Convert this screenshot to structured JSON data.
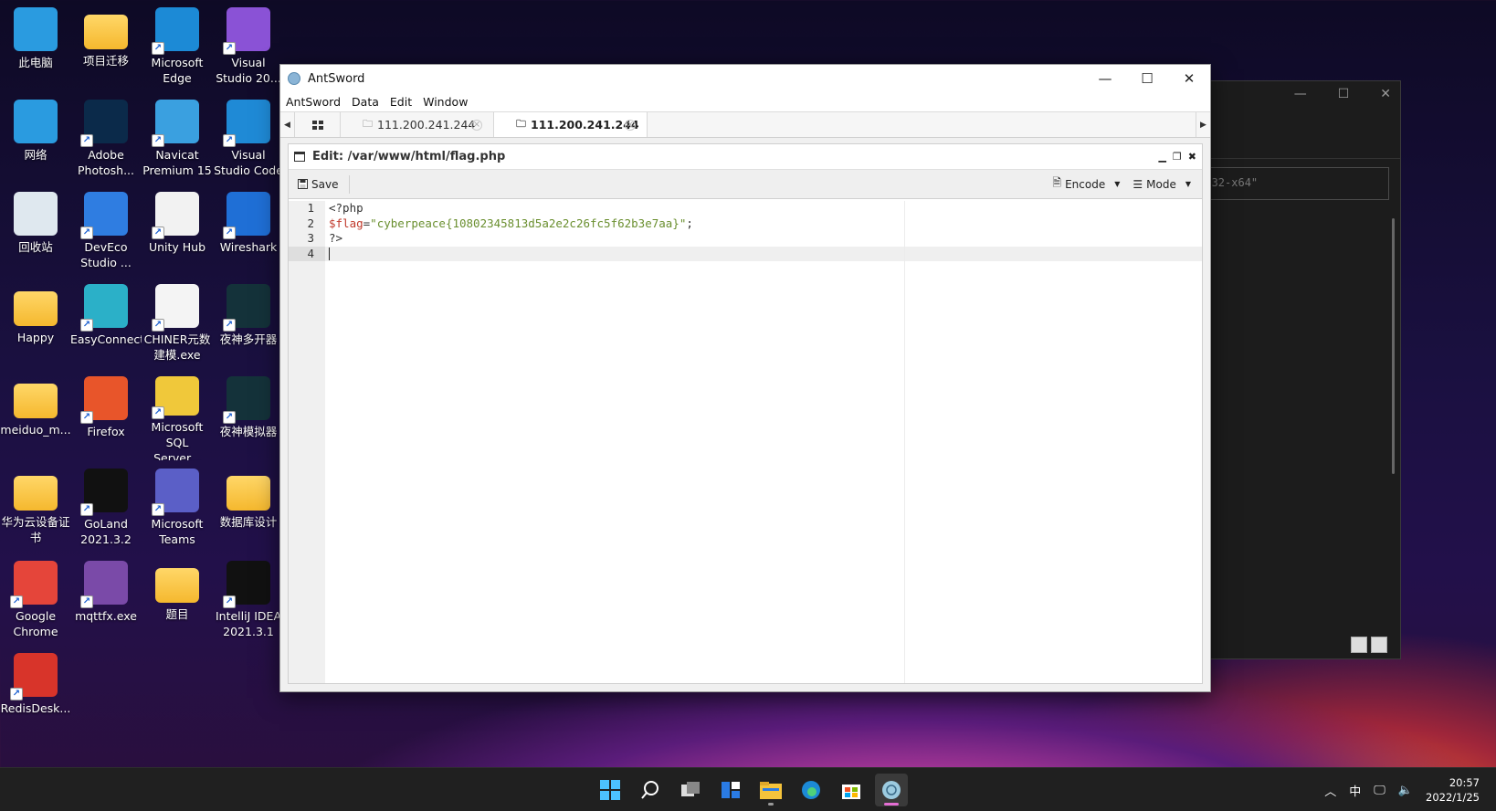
{
  "desktop": {
    "icons": [
      {
        "label": "此电脑",
        "icon": "computer-icon",
        "color": "#2a9be0"
      },
      {
        "label": "项目迁移",
        "icon": "folder-icon",
        "color": "#f5b82e"
      },
      {
        "label": "Microsoft Edge",
        "icon": "edge-icon",
        "color": "#1c8ad6"
      },
      {
        "label": "Visual Studio 20...",
        "icon": "visual-studio-icon",
        "color": "#8a52d6"
      },
      {
        "label": "网络",
        "icon": "network-icon",
        "color": "#2a9be0"
      },
      {
        "label": "Adobe Photosh...",
        "icon": "photoshop-icon",
        "color": "#0b2a4a"
      },
      {
        "label": "Navicat Premium 15",
        "icon": "navicat-icon",
        "color": "#3aa0e0"
      },
      {
        "label": "Visual Studio Code",
        "icon": "vscode-icon",
        "color": "#1f8ad6"
      },
      {
        "label": "回收站",
        "icon": "recycle-bin-icon",
        "color": "#dfe8ef"
      },
      {
        "label": "DevEco Studio ...",
        "icon": "deveco-icon",
        "color": "#2f7de1"
      },
      {
        "label": "Unity Hub",
        "icon": "unity-hub-icon",
        "color": "#f2f2f2"
      },
      {
        "label": "Wireshark",
        "icon": "wireshark-icon",
        "color": "#1f6fd6"
      },
      {
        "label": "Happy",
        "icon": "folder-icon",
        "color": "#f5b82e"
      },
      {
        "label": "EasyConnect",
        "icon": "easyconnect-icon",
        "color": "#2bb0c8"
      },
      {
        "label": "CHINER元数建模.exe",
        "icon": "chiner-icon",
        "color": "#f4f4f4"
      },
      {
        "label": "夜神多开器",
        "icon": "nox-multi-icon",
        "color": "#14323a"
      },
      {
        "label": "meiduo_m...",
        "icon": "folder-icon",
        "color": "#f5b82e"
      },
      {
        "label": "Firefox",
        "icon": "firefox-icon",
        "color": "#e8552a"
      },
      {
        "label": "Microsoft SQL Server...",
        "icon": "sql-server-icon",
        "color": "#f0c83a"
      },
      {
        "label": "夜神模拟器",
        "icon": "nox-icon",
        "color": "#14323a"
      },
      {
        "label": "华为云设备证书",
        "icon": "folder-icon",
        "color": "#f5b82e"
      },
      {
        "label": "GoLand 2021.3.2",
        "icon": "goland-icon",
        "color": "#111111"
      },
      {
        "label": "Microsoft Teams",
        "icon": "teams-icon",
        "color": "#5b5fc7"
      },
      {
        "label": "数据库设计",
        "icon": "folder-icon",
        "color": "#f5b82e"
      },
      {
        "label": "Google Chrome",
        "icon": "chrome-icon",
        "color": "#e5453a"
      },
      {
        "label": "mqttfx.exe",
        "icon": "mqttfx-icon",
        "color": "#7a4aa8"
      },
      {
        "label": "题目",
        "icon": "folder-icon",
        "color": "#f5b82e"
      },
      {
        "label": "IntelliJ IDEA 2021.3.1",
        "icon": "intellij-icon",
        "color": "#111111"
      },
      {
        "label": "RedisDesk...",
        "icon": "redis-icon",
        "color": "#d8342a"
      }
    ]
  },
  "bg_window": {
    "field_text": "1.2-win32-x64\""
  },
  "antsword": {
    "title": "AntSword",
    "menu": [
      "AntSword",
      "Data",
      "Edit",
      "Window"
    ],
    "tabs": [
      {
        "label": "111.200.241.244",
        "active": false
      },
      {
        "label": "111.200.241.244",
        "active": true
      }
    ],
    "panel_title": "Edit: /var/www/html/flag.php",
    "toolbar": {
      "save": "Save",
      "encode": "Encode",
      "mode": "Mode"
    },
    "editor": {
      "line_numbers": [
        "1",
        "2",
        "3",
        "4"
      ],
      "line1": "<?php",
      "line2_var": "$flag",
      "line2_eq": "=",
      "line2_str": "\"cyberpeace{10802345813d5a2e2c26fc5f62b3e7aa}\"",
      "line2_end": ";",
      "line3": "?>"
    }
  },
  "taskbar": {
    "apps": [
      "start-icon",
      "search-icon",
      "task-view-icon",
      "widgets-icon",
      "file-explorer-icon",
      "edge-icon",
      "store-icon",
      "antsword-icon"
    ],
    "ime": "中",
    "time": "20:57",
    "date": "2022/1/25"
  }
}
